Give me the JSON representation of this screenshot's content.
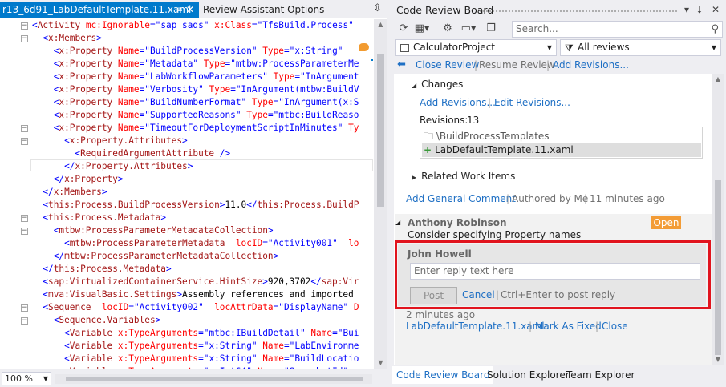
{
  "editor": {
    "tab_title": "r13_6d91_LabDefaultTemplate.11.xaml",
    "tab_pin": "≡",
    "tab_close": "✕",
    "second_tab": "Review Assistant Options",
    "zoom": "100 %",
    "lines": [
      {
        "text": "<Activity mc:Ignorable=\"sap sads\" x:Class=\"TfsBuild.Process\" "
      },
      {
        "text": "  <x:Members>"
      },
      {
        "text": "    <x:Property Name=\"BuildProcessVersion\" Type=\"x:String\" "
      },
      {
        "text": "    <x:Property Name=\"Metadata\" Type=\"mtbw:ProcessParameterMe"
      },
      {
        "text": "    <x:Property Name=\"LabWorkflowParameters\" Type=\"InArgument"
      },
      {
        "text": "    <x:Property Name=\"Verbosity\" Type=\"InArgument(mtbw:BuildV"
      },
      {
        "text": "    <x:Property Name=\"BuildNumberFormat\" Type=\"InArgument(x:S"
      },
      {
        "text": "    <x:Property Name=\"SupportedReasons\" Type=\"mtbc:BuildReaso"
      },
      {
        "text": "    <x:Property Name=\"TimeoutForDeploymentScriptInMinutes\" Ty"
      },
      {
        "text": "      <x:Property.Attributes>"
      },
      {
        "text": "        <RequiredArgumentAttribute />"
      },
      {
        "text": "      </x:Property.Attributes>"
      },
      {
        "text": "    </x:Property>"
      },
      {
        "text": "  </x:Members>"
      },
      {
        "text": "  <this:Process.BuildProcessVersion>11.0</this:Process.BuildP"
      },
      {
        "text": "  <this:Process.Metadata>"
      },
      {
        "text": "    <mtbw:ProcessParameterMetadataCollection>"
      },
      {
        "text": "      <mtbw:ProcessParameterMetadata _locID=\"Activity001\" _lo"
      },
      {
        "text": "    </mtbw:ProcessParameterMetadataCollection>"
      },
      {
        "text": "  </this:Process.Metadata>"
      },
      {
        "text": "  <sap:VirtualizedContainerService.HintSize>920,3702</sap:Vir"
      },
      {
        "text": "  <mva:VisualBasic.Settings>Assembly references and imported "
      },
      {
        "text": "  <Sequence _locID=\"Activity002\" _locAttrData=\"DisplayName\" D"
      },
      {
        "text": "    <Sequence.Variables>"
      },
      {
        "text": "      <Variable x:TypeArguments=\"mtbc:IBuildDetail\" Name=\"Bui"
      },
      {
        "text": "      <Variable x:TypeArguments=\"x:String\" Name=\"LabEnvironme"
      },
      {
        "text": "      <Variable x:TypeArguments=\"x:String\" Name=\"BuildLocatio"
      },
      {
        "text": "      <Variable x:TypeArguments=\"x:Int64\" Name=\"SnapshotId\" "
      }
    ]
  },
  "panel": {
    "title": "Code Review Board",
    "title_controls": [
      "▾",
      "⭣",
      "✕"
    ],
    "search_placeholder": "Search...",
    "project": "CalculatorProject",
    "filter": "All reviews",
    "actions": {
      "close_review": "Close Review",
      "resume_review": "Resume Review",
      "add_revisions": "Add Revisions..."
    },
    "changes": {
      "header": "Changes",
      "add_revisions": "Add Revisions...",
      "edit_revisions": "Edit Revisions...",
      "revisions_label": "Revisions:",
      "revisions_count": "13",
      "folder": "\\BuildProcessTemplates",
      "file": "LabDefaultTemplate.11.xaml"
    },
    "related_work_items": "Related Work Items",
    "general": {
      "add_comment": "Add General Comment",
      "authored_by": "Authored by Me",
      "time": "11 minutes ago"
    },
    "comment": {
      "author": "Anthony Robinson",
      "status": "Open",
      "text": "Consider specifying Property names",
      "time": "2 minutes ago",
      "file_link": "LabDefaultTemplate.11.xaml",
      "mark_fixed": "Mark As Fixed",
      "close": "Close"
    },
    "reply": {
      "author": "John Howell",
      "placeholder": "Enter reply text here",
      "post": "Post",
      "cancel": "Cancel",
      "hint": "Ctrl+Enter to post reply"
    },
    "bottom_tabs": [
      "Code Review Board",
      "Solution Explorer",
      "Team Explorer"
    ]
  },
  "colors": {
    "accent": "#007acc",
    "link": "#1e6fc4",
    "badge_open": "#f39c36",
    "highlight": "#e1141e"
  }
}
